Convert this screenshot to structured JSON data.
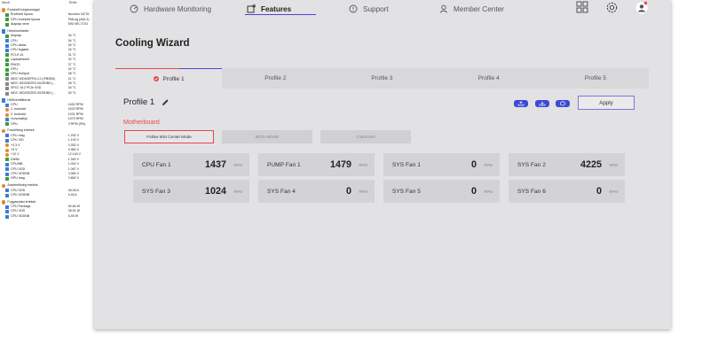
{
  "sensor_panel": {
    "header": {
      "col1": "Mező",
      "col2": "Érték"
    },
    "groups": [
      {
        "title": "Érzékelő tulajdonságai",
        "icon": "orange",
        "rows": [
          {
            "label": "Érzékelő típusa",
            "value": "Nuvoton NCT6",
            "icon": "green"
          },
          {
            "label": "GPU érzékelő típusa",
            "value": "PMLog (ADL2)",
            "icon": "green"
          },
          {
            "label": "Alaplap neve",
            "value": "MSI MS-7C91",
            "icon": "green"
          }
        ]
      },
      {
        "title": "Hőmérsékletek",
        "icon": "blue",
        "rows": [
          {
            "label": "Alaplap",
            "value": "34 °C",
            "icon": "green"
          },
          {
            "label": "CPU",
            "value": "54 °C",
            "icon": "blue"
          },
          {
            "label": "CPU dióda",
            "value": "55 °C",
            "icon": "blue"
          },
          {
            "label": "CPU foglalat",
            "value": "34 °C",
            "icon": "blue"
          },
          {
            "label": "PCI-E #1",
            "value": "31 °C",
            "icon": "green"
          },
          {
            "label": "Lapkakészlet",
            "value": "32 °C",
            "icon": "green"
          },
          {
            "label": "PMOS",
            "value": "37 °C",
            "icon": "green"
          },
          {
            "label": "GPU",
            "value": "42 °C",
            "icon": "green"
          },
          {
            "label": "GPU Hotspot",
            "value": "48 °C",
            "icon": "green"
          },
          {
            "label": "WDC WD40EFRX-2-0 (FB0B0)",
            "value": "21 °C",
            "icon": "grey"
          },
          {
            "label": "WDC WD20EZRZ-00Z5HB0 (...",
            "value": "28 °C",
            "icon": "grey"
          },
          {
            "label": "SPCC M.2 PCIe SSD",
            "value": "34 °C",
            "icon": "grey"
          },
          {
            "label": "WDC WD20EZRZ-00Z5HB0 (...",
            "value": "30 °C",
            "icon": "grey"
          }
        ]
      },
      {
        "title": "Hűtőventilátorok",
        "icon": "blue",
        "rows": [
          {
            "label": "CPU",
            "value": "1432 RPM",
            "icon": "blue"
          },
          {
            "label": "2. burkolat",
            "value": "4223 RPM",
            "icon": "orange"
          },
          {
            "label": "3. burkolat",
            "value": "1031 RPM",
            "icon": "orange"
          },
          {
            "label": "Vízszivattyú",
            "value": "1479 RPM",
            "icon": "blue"
          },
          {
            "label": "GPU",
            "value": "0 RPM (0%)",
            "icon": "green"
          }
        ]
      },
      {
        "title": "Feszültség értékek",
        "icon": "orange",
        "rows": [
          {
            "label": "CPU mag",
            "value": "1.292 V",
            "icon": "blue"
          },
          {
            "label": "CPU VID",
            "value": "1.100 V",
            "icon": "blue"
          },
          {
            "label": "+3.3 V",
            "value": "3.352 V",
            "icon": "orange"
          },
          {
            "label": "+5 V",
            "value": "4.960 V",
            "icon": "orange"
          },
          {
            "label": "+12 V",
            "value": "12.144 V",
            "icon": "orange"
          },
          {
            "label": "DIMM",
            "value": "1.340 V",
            "icon": "green"
          },
          {
            "label": "CPU/NB",
            "value": "1.002 V",
            "icon": "blue"
          },
          {
            "label": "CPU VDD",
            "value": "1.087 V",
            "icon": "blue"
          },
          {
            "label": "CPU VDDNB",
            "value": "0.984 V",
            "icon": "blue"
          },
          {
            "label": "GPU mag",
            "value": "0.862 V",
            "icon": "green"
          }
        ]
      },
      {
        "title": "Áramerősség értékek",
        "icon": "orange",
        "rows": [
          {
            "label": "CPU VDD",
            "value": "28.05 A",
            "icon": "blue"
          },
          {
            "label": "CPU VDDNB",
            "value": "6.45 A",
            "icon": "blue"
          }
        ]
      },
      {
        "title": "Fogyasztási értékek",
        "icon": "orange",
        "rows": [
          {
            "label": "CPU Package",
            "value": "50.84 W",
            "icon": "blue"
          },
          {
            "label": "CPU VDD",
            "value": "38.51 W",
            "icon": "blue"
          },
          {
            "label": "CPU VDDNB",
            "value": "6.45 W",
            "icon": "blue"
          }
        ]
      }
    ]
  },
  "nav": {
    "tabs": [
      {
        "label": "Hardware Monitoring",
        "icon": "speedometer-icon"
      },
      {
        "label": "Features",
        "icon": "features-icon"
      },
      {
        "label": "Support",
        "icon": "support-icon"
      },
      {
        "label": "Member Center",
        "icon": "user-icon"
      }
    ],
    "active_tab": "Features"
  },
  "page": {
    "title": "Cooling Wizard"
  },
  "profiles": {
    "tabs": [
      "Profile 1",
      "Profile 2",
      "Profile 3",
      "Profile 4",
      "Profile 5"
    ],
    "active": "Profile 1",
    "current_name": "Profile 1"
  },
  "actions": {
    "apply_label": "Apply"
  },
  "section": {
    "label": "Motherboard"
  },
  "modes": [
    {
      "label": "Follow MSI Center Mode",
      "selected": true
    },
    {
      "label": "BIOS MODE",
      "selected": false
    },
    {
      "label": "Customize",
      "selected": false
    }
  ],
  "fans": [
    {
      "name": "CPU Fan 1",
      "value": "1437",
      "unit": "RPM"
    },
    {
      "name": "PUMP Fan 1",
      "value": "1479",
      "unit": "RPM"
    },
    {
      "name": "SYS Fan 1",
      "value": "0",
      "unit": "RPM"
    },
    {
      "name": "SYS Fan 2",
      "value": "4225",
      "unit": "RPM"
    },
    {
      "name": "SYS Fan 3",
      "value": "1024",
      "unit": "RPM"
    },
    {
      "name": "SYS Fan 4",
      "value": "0",
      "unit": "RPM"
    },
    {
      "name": "SYS Fan 5",
      "value": "0",
      "unit": "RPM"
    },
    {
      "name": "SYS Fan 6",
      "value": "0",
      "unit": "RPM"
    }
  ],
  "colors": {
    "accent_red": "#e2494d",
    "accent_purple": "#5b3fd6",
    "icon_blue": "#3d4ad6"
  }
}
